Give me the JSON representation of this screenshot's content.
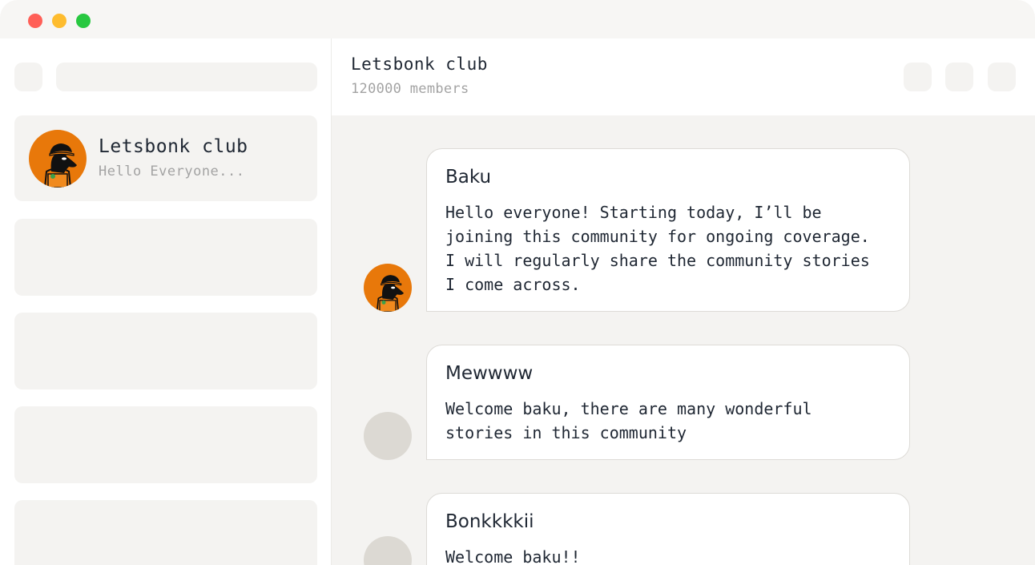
{
  "window": {
    "controls": [
      "close",
      "minimize",
      "maximize"
    ]
  },
  "sidebar": {
    "active_chat": {
      "name": "Letsbonk club",
      "preview": "Hello Everyone..."
    }
  },
  "header": {
    "title": "Letsbonk club",
    "subtitle": "120000 members"
  },
  "messages": [
    {
      "author": "Baku",
      "text": "Hello everyone! Starting today, I’ll be\njoining this community for ongoing coverage.\nI will regularly share the community stories\nI come across."
    },
    {
      "author": "Mewwww",
      "text": "Welcome baku, there are many wonderful\nstories in this community"
    },
    {
      "author": "Bonkkkkii",
      "text": "Welcome baku!!"
    }
  ],
  "colors": {
    "accent": "#e8780a",
    "panel": "#f4f3f1"
  }
}
